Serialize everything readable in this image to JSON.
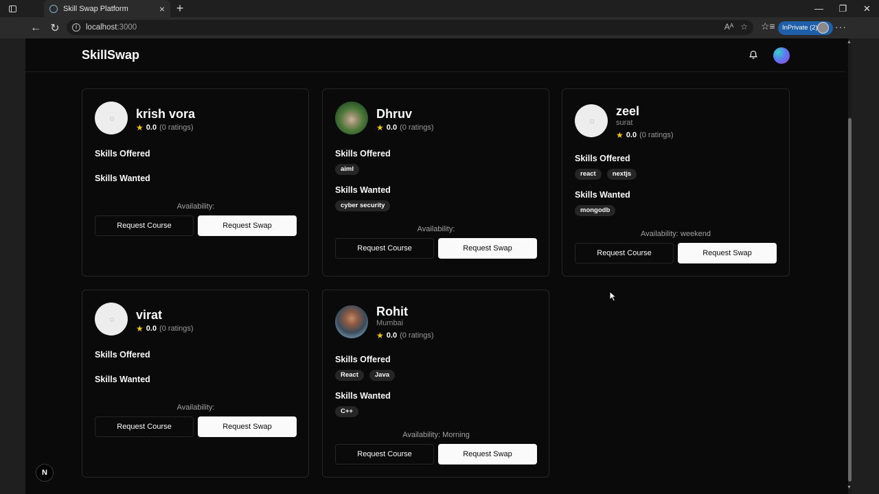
{
  "browser": {
    "tab_title": "Skill Swap Platform",
    "url_host": "localhost",
    "url_port": ":3000",
    "inprivate_label": "InPrivate (2)"
  },
  "header": {
    "brand": "SkillSwap"
  },
  "labels": {
    "skills_offered": "Skills Offered",
    "skills_wanted": "Skills Wanted",
    "request_course": "Request Course",
    "request_swap": "Request Swap"
  },
  "users": [
    {
      "name": "krish vora",
      "location": "",
      "rating": "0.0",
      "ratings_count": "(0 ratings)",
      "avatar": "placeholder",
      "skills_offered": [],
      "skills_wanted": [],
      "availability": "Availability:"
    },
    {
      "name": "Dhruv",
      "location": "",
      "rating": "0.0",
      "ratings_count": "(0 ratings)",
      "avatar": "photo",
      "skills_offered": [
        "aiml"
      ],
      "skills_wanted": [
        "cyber security"
      ],
      "availability": "Availability:"
    },
    {
      "name": "zeel",
      "location": "surat",
      "rating": "0.0",
      "ratings_count": "(0 ratings)",
      "avatar": "placeholder",
      "skills_offered": [
        "react",
        "nextjs"
      ],
      "skills_wanted": [
        "mongodb"
      ],
      "availability": "Availability: weekend"
    },
    {
      "name": "virat",
      "location": "",
      "rating": "0.0",
      "ratings_count": "(0 ratings)",
      "avatar": "placeholder",
      "skills_offered": [],
      "skills_wanted": [],
      "availability": "Availability:"
    },
    {
      "name": "Rohit",
      "location": "Mumbai",
      "rating": "0.0",
      "ratings_count": "(0 ratings)",
      "avatar": "photo",
      "skills_offered": [
        "React",
        "Java"
      ],
      "skills_wanted": [
        "C++"
      ],
      "availability": "Availability: Morning"
    }
  ],
  "next_badge": "N"
}
